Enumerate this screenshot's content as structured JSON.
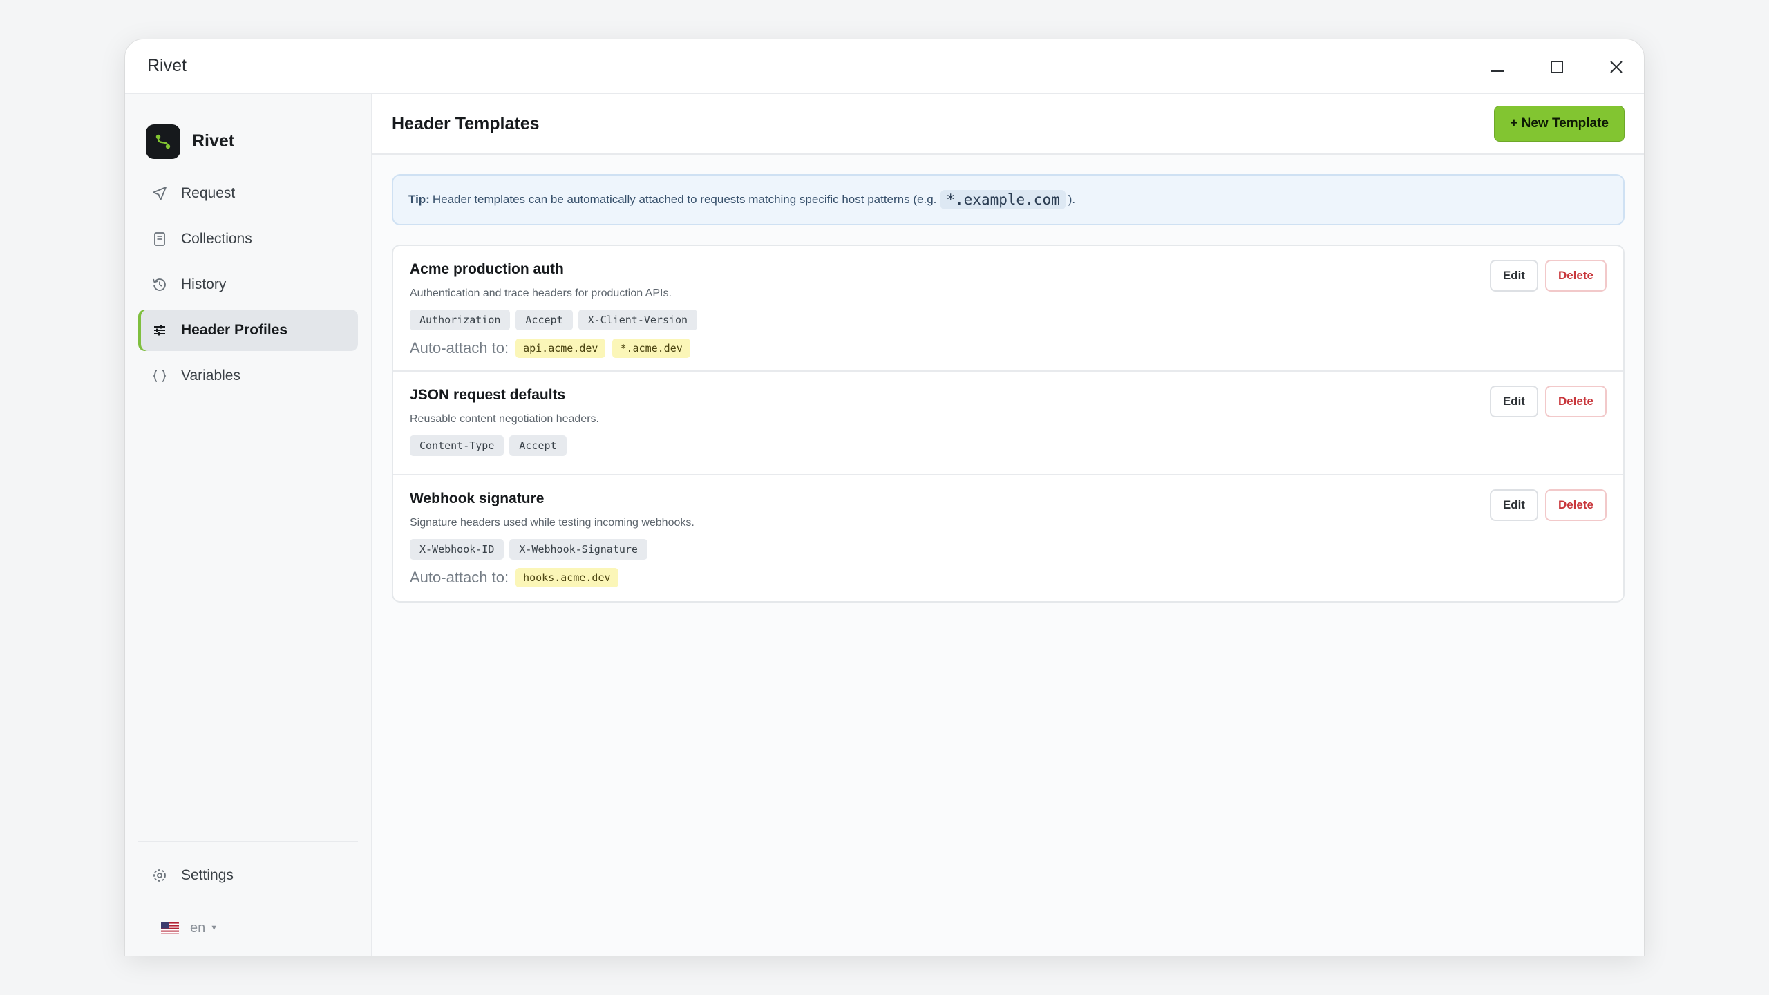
{
  "window": {
    "title": "Rivet"
  },
  "sidebar": {
    "brand_name": "Rivet",
    "items": [
      {
        "label": "Request",
        "icon": "send-icon",
        "active": false
      },
      {
        "label": "Collections",
        "icon": "document-icon",
        "active": false
      },
      {
        "label": "History",
        "icon": "history-icon",
        "active": false
      },
      {
        "label": "Header Profiles",
        "icon": "sliders-icon",
        "active": true
      },
      {
        "label": "Variables",
        "icon": "braces-icon",
        "active": false
      }
    ],
    "settings_label": "Settings",
    "language": {
      "code": "en",
      "flag": "us-flag-icon"
    }
  },
  "main": {
    "title": "Header Templates",
    "new_button": "+ New Template",
    "tip": {
      "label": "Tip:",
      "text": "Header templates can be automatically attached to requests matching specific host patterns (e.g.",
      "example": "*.example.com",
      "suffix": ")."
    },
    "templates": [
      {
        "name": "Acme production auth",
        "description": "Authentication and trace headers for production APIs.",
        "headers": [
          "Authorization",
          "Accept",
          "X-Client-Version"
        ],
        "auto_attach_label": "Auto-attach to:",
        "hosts": [
          "api.acme.dev",
          "*.acme.dev"
        ]
      },
      {
        "name": "JSON request defaults",
        "description": "Reusable content negotiation headers.",
        "headers": [
          "Content-Type",
          "Accept"
        ],
        "auto_attach_label": "",
        "hosts": []
      },
      {
        "name": "Webhook signature",
        "description": "Signature headers used while testing incoming webhooks.",
        "headers": [
          "X-Webhook-ID",
          "X-Webhook-Signature"
        ],
        "auto_attach_label": "Auto-attach to:",
        "hosts": [
          "hooks.acme.dev"
        ]
      }
    ],
    "edit_label": "Edit",
    "delete_label": "Delete"
  },
  "colors": {
    "accent": "#82c531",
    "danger": "#c8353a",
    "tip_bg": "#eef5fc",
    "host_bg": "#fbf6b8"
  }
}
